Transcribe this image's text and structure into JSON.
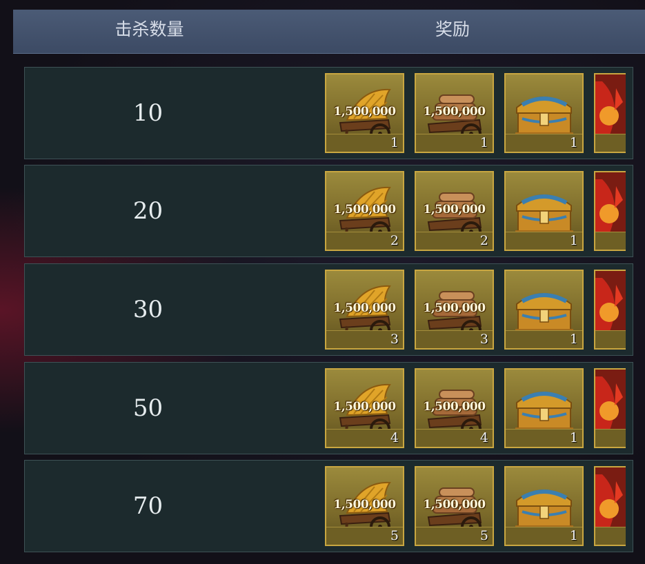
{
  "header": {
    "kills_label": "击杀数量",
    "reward_label": "奖励"
  },
  "rows": [
    {
      "kills": "10",
      "rewards": [
        {
          "icon": "grain-cart-icon",
          "amount": "1,500,000",
          "qty": "1"
        },
        {
          "icon": "wood-cart-icon",
          "amount": "1,500,000",
          "qty": "1"
        },
        {
          "icon": "treasure-chest-icon",
          "amount": "",
          "qty": "1"
        },
        {
          "icon": "red-reward-icon",
          "amount": "",
          "qty": ""
        }
      ]
    },
    {
      "kills": "20",
      "rewards": [
        {
          "icon": "grain-cart-icon",
          "amount": "1,500,000",
          "qty": "2"
        },
        {
          "icon": "wood-cart-icon",
          "amount": "1,500,000",
          "qty": "2"
        },
        {
          "icon": "treasure-chest-icon",
          "amount": "",
          "qty": "1"
        },
        {
          "icon": "red-reward-icon",
          "amount": "",
          "qty": ""
        }
      ]
    },
    {
      "kills": "30",
      "rewards": [
        {
          "icon": "grain-cart-icon",
          "amount": "1,500,000",
          "qty": "3"
        },
        {
          "icon": "wood-cart-icon",
          "amount": "1,500,000",
          "qty": "3"
        },
        {
          "icon": "treasure-chest-icon",
          "amount": "",
          "qty": "1"
        },
        {
          "icon": "red-reward-icon",
          "amount": "",
          "qty": ""
        }
      ]
    },
    {
      "kills": "50",
      "rewards": [
        {
          "icon": "grain-cart-icon",
          "amount": "1,500,000",
          "qty": "4"
        },
        {
          "icon": "wood-cart-icon",
          "amount": "1,500,000",
          "qty": "4"
        },
        {
          "icon": "treasure-chest-icon",
          "amount": "",
          "qty": "1"
        },
        {
          "icon": "red-reward-icon",
          "amount": "",
          "qty": ""
        }
      ]
    },
    {
      "kills": "70",
      "rewards": [
        {
          "icon": "grain-cart-icon",
          "amount": "1,500,000",
          "qty": "5"
        },
        {
          "icon": "wood-cart-icon",
          "amount": "1,500,000",
          "qty": "5"
        },
        {
          "icon": "treasure-chest-icon",
          "amount": "",
          "qty": "1"
        },
        {
          "icon": "red-reward-icon",
          "amount": "",
          "qty": ""
        }
      ]
    }
  ]
}
